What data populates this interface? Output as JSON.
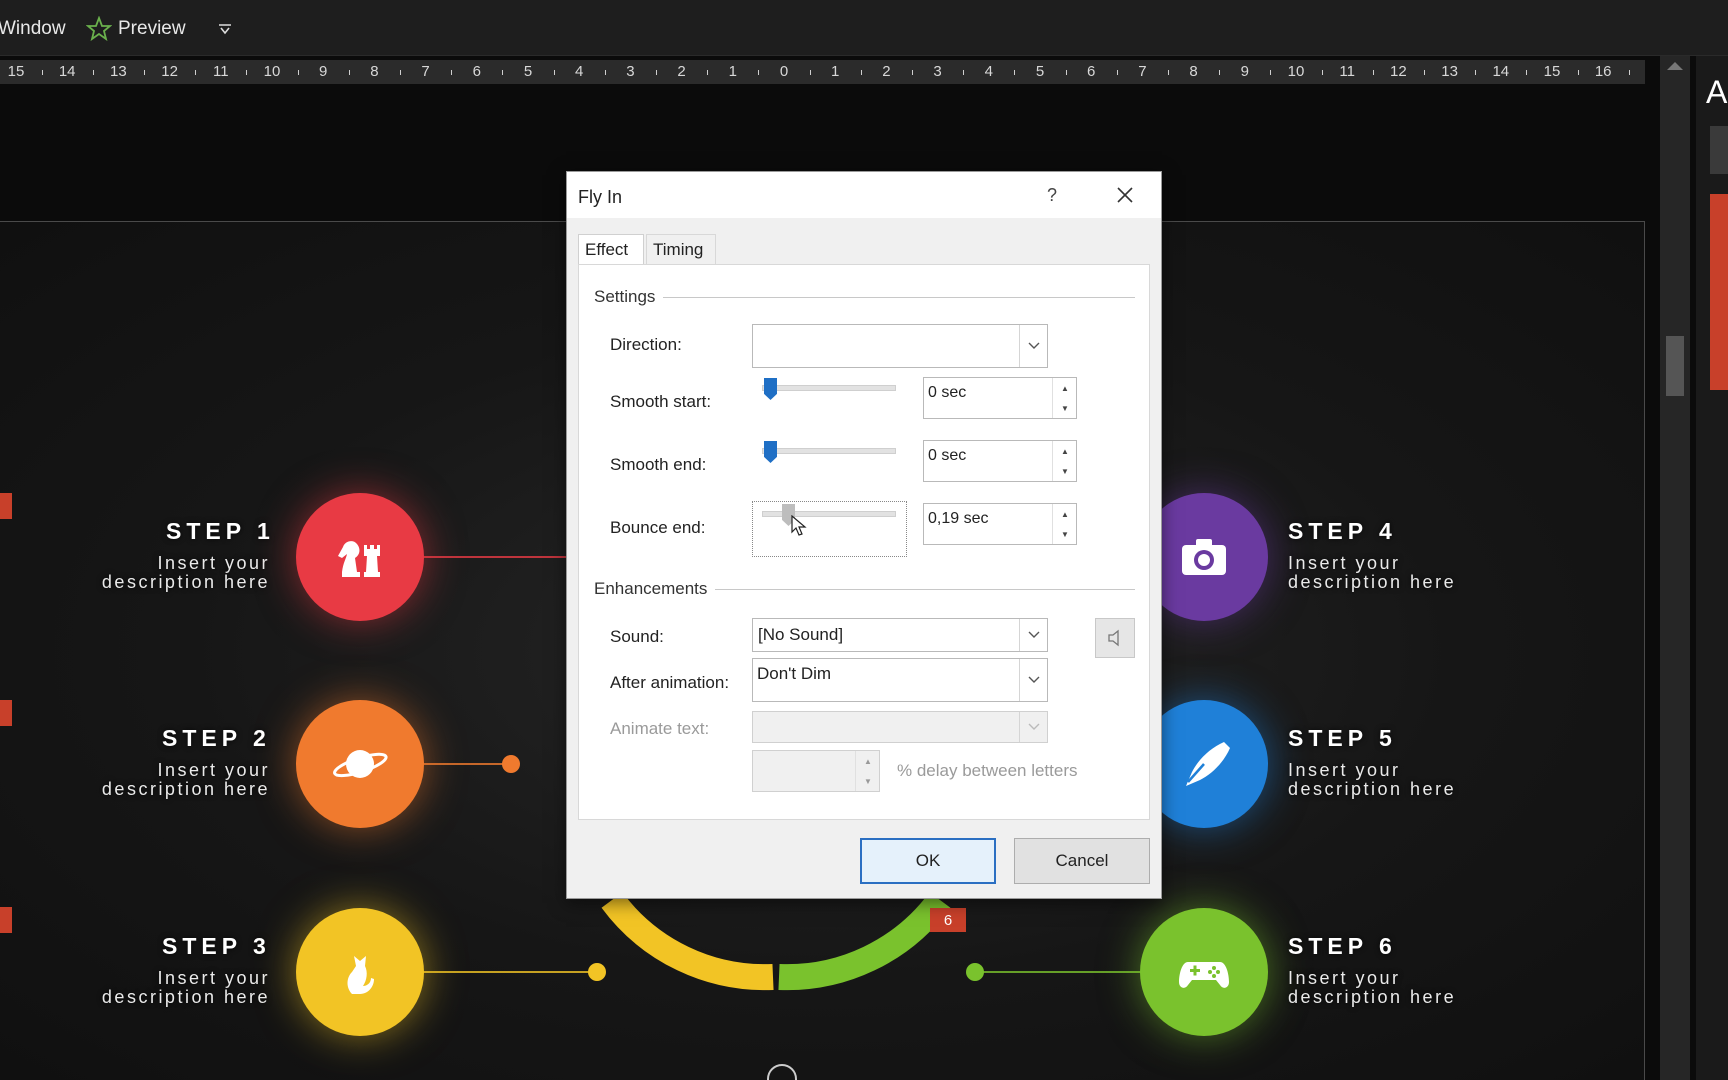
{
  "topbar": {
    "window_menu": "Window",
    "preview_label": "Preview",
    "dropdown_icon": "chevron-down-icon"
  },
  "ruler": {
    "labels": [
      "15",
      "14",
      "13",
      "12",
      "11",
      "10",
      "9",
      "8",
      "7",
      "6",
      "5",
      "4",
      "3",
      "2",
      "1",
      "0",
      "1",
      "2",
      "3",
      "4",
      "5",
      "6",
      "7",
      "8",
      "9",
      "10",
      "11",
      "12",
      "13",
      "14",
      "15",
      "16"
    ]
  },
  "slide": {
    "steps": [
      {
        "title": "STEP 1",
        "desc1": "Insert your",
        "desc2": "description here",
        "color": "#e83a44",
        "icon": "chess-pieces-icon"
      },
      {
        "title": "STEP 2",
        "desc1": "Insert your",
        "desc2": "description here",
        "color": "#f07a2e",
        "icon": "planet-icon"
      },
      {
        "title": "STEP 3",
        "desc1": "Insert your",
        "desc2": "description here",
        "color": "#f2c425",
        "icon": "cat-icon"
      },
      {
        "title": "STEP 4",
        "desc1": "Insert your",
        "desc2": "description here",
        "color": "#6a3aa0",
        "icon": "camera-icon"
      },
      {
        "title": "STEP 5",
        "desc1": "Insert your",
        "desc2": "description here",
        "color": "#1f80d8",
        "icon": "pen-nib-icon"
      },
      {
        "title": "STEP 6",
        "desc1": "Insert your",
        "desc2": "description here",
        "color": "#7ac22d",
        "icon": "gamepad-icon"
      }
    ],
    "animation_badge": "6",
    "right_panel_letter": "A"
  },
  "dialog": {
    "title": "Fly In",
    "help": "?",
    "tabs": [
      {
        "label": "Effect",
        "active": true
      },
      {
        "label": "Timing",
        "active": false
      }
    ],
    "settings": {
      "group_label": "Settings",
      "direction_label": "Direction:",
      "direction_value": "",
      "smooth_start_label": "Smooth start:",
      "smooth_start_value": "0 sec",
      "smooth_end_label": "Smooth end:",
      "smooth_end_value": "0 sec",
      "bounce_end_label": "Bounce end:",
      "bounce_end_value": "0,19 sec"
    },
    "enhancements": {
      "group_label": "Enhancements",
      "sound_label": "Sound:",
      "sound_value": "[No Sound]",
      "after_animation_label": "After animation:",
      "after_animation_value": "Don't Dim",
      "animate_text_label": "Animate text:",
      "animate_text_value": "",
      "delay_value": "",
      "delay_label": "% delay between letters"
    },
    "buttons": {
      "ok": "OK",
      "cancel": "Cancel"
    }
  }
}
